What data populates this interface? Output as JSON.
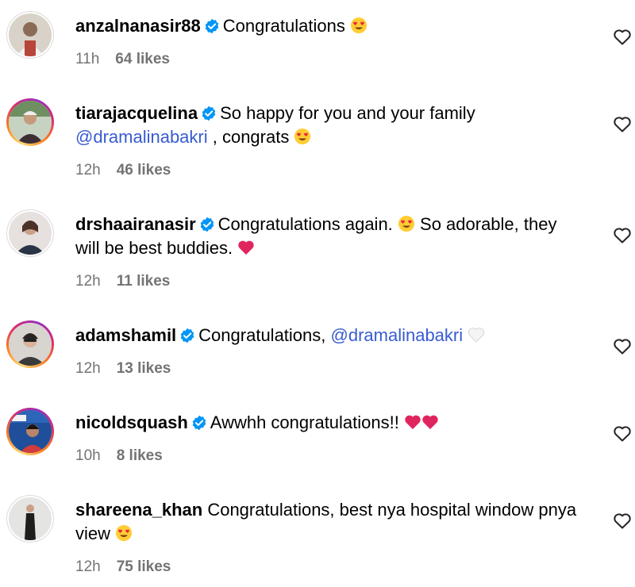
{
  "comments": [
    {
      "username": "anzalnanasir88",
      "verified": true,
      "text_before": "Congratulations ",
      "emoji": "heart-eyes",
      "time": "11h",
      "likes": "64 likes"
    },
    {
      "username": "tiarajacquelina",
      "verified": true,
      "text_before": "So happy for you and your family",
      "mention": "@dramalinabakri",
      "text_after": " , congrats ",
      "emoji": "heart-eyes",
      "time": "12h",
      "likes": "46 likes"
    },
    {
      "username": "drshaairanasir",
      "verified": true,
      "text_before": "Congratulations again. ",
      "text_mid": " So adorable, they will be best buddies. ",
      "time": "12h",
      "likes": "11 likes"
    },
    {
      "username": "adamshamil",
      "verified": true,
      "text_before": "Congratulations, ",
      "mention": "@dramalinabakri",
      "time": "12h",
      "likes": "13 likes"
    },
    {
      "username": "nicoldsquash",
      "verified": true,
      "text_before": "Awwhh congratulations!! ",
      "time": "10h",
      "likes": "8 likes"
    },
    {
      "username": "shareena_khan",
      "verified": false,
      "text_before": "Congratulations, best nya hospital window pnya view ",
      "time": "12h",
      "likes": "75 likes"
    }
  ],
  "colors": {
    "mention": "#385bd1",
    "verified": "#0095f6",
    "meta": "#737373",
    "red_heart": "#e0245e"
  },
  "icons": {
    "verified": "verified-badge-icon",
    "like": "heart-outline-icon",
    "emoji_heart_eyes": "heart-eyes-emoji-icon",
    "emoji_red_heart": "red-heart-emoji-icon",
    "emoji_white_heart": "white-heart-emoji-icon"
  }
}
